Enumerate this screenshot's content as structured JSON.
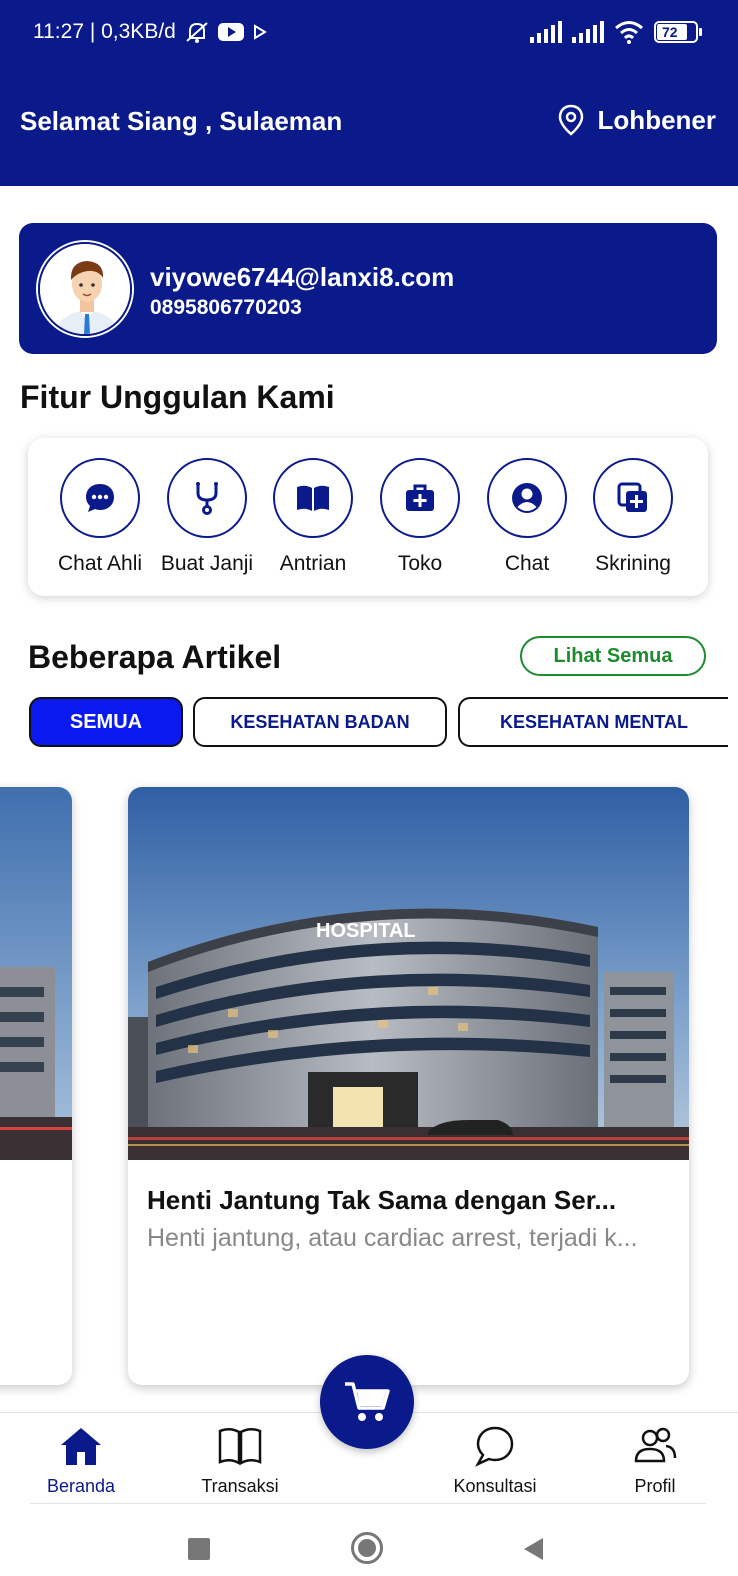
{
  "status_bar": {
    "time_info": "11:27 | 0,3KB/d",
    "battery": "72"
  },
  "header": {
    "greeting": "Selamat Siang , Sulaeman",
    "location": "Lohbener",
    "bg_color": "#0a1a8a"
  },
  "profile": {
    "email": "viyowe6744@lanxi8.com",
    "phone": "0895806770203"
  },
  "features": {
    "title": "Fitur Unggulan Kami",
    "items": [
      {
        "label": "Chat Ahli",
        "icon": "chat-bubble-icon"
      },
      {
        "label": "Buat Janji",
        "icon": "stethoscope-icon"
      },
      {
        "label": "Antrian",
        "icon": "book-icon"
      },
      {
        "label": "Toko",
        "icon": "medical-bag-icon"
      },
      {
        "label": "Chat",
        "icon": "user-circle-icon"
      },
      {
        "label": "Skrining",
        "icon": "add-copy-icon"
      }
    ]
  },
  "articles": {
    "title": "Beberapa Artikel",
    "see_all": "Lihat Semua",
    "chips": [
      "SEMUA",
      "KESEHATAN BADAN",
      "KESEHATAN MENTAL"
    ],
    "active_chip": "SEMUA",
    "items": [
      {
        "image_sign": "HOSPITAL",
        "title": "Henti Jantung Tak Sama dengan Ser...",
        "description": "Henti jantung, atau cardiac arrest, terjadi k..."
      }
    ]
  },
  "bottom_nav": {
    "items": [
      {
        "label": "Beranda",
        "icon": "home-icon",
        "active": true
      },
      {
        "label": "Transaksi",
        "icon": "book-open-icon",
        "active": false
      },
      {
        "label": "Konsultasi",
        "icon": "chat-icon",
        "active": false
      },
      {
        "label": "Profil",
        "icon": "users-icon",
        "active": false
      }
    ],
    "fab_icon": "cart-icon"
  }
}
